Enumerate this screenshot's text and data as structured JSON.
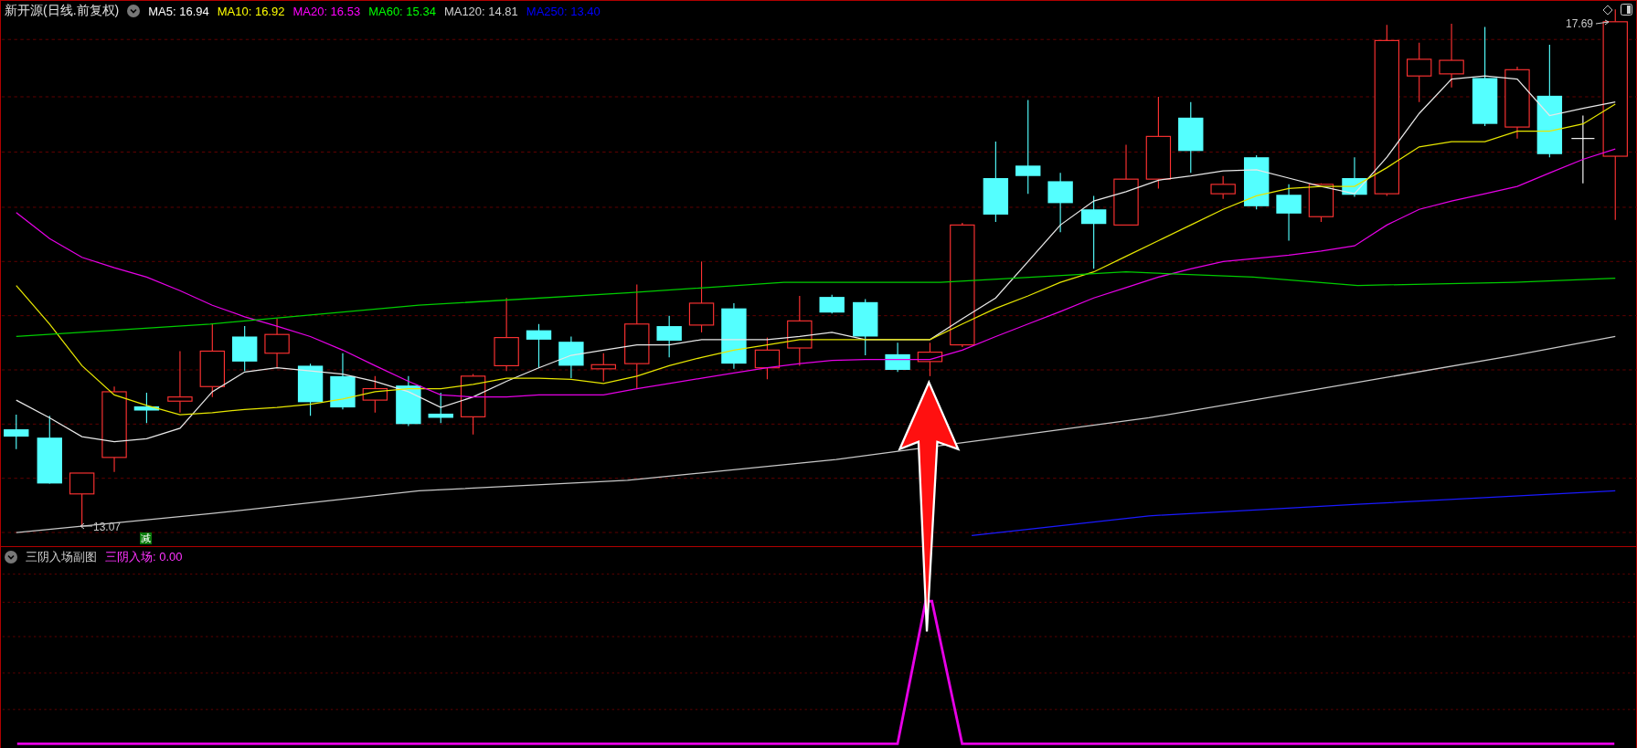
{
  "main_chart": {
    "title": "新开源(日线.前复权)",
    "moving_averages": [
      {
        "label": "MA5: 16.94",
        "color": "#ffffff"
      },
      {
        "label": "MA10: 16.92",
        "color": "#ffff00"
      },
      {
        "label": "MA20: 16.53",
        "color": "#ff00ff"
      },
      {
        "label": "MA60: 15.34",
        "color": "#00ff00"
      },
      {
        "label": "MA120: 14.81",
        "color": "#d0d0d0"
      },
      {
        "label": "MA250: 13.40",
        "color": "#0000ff"
      }
    ],
    "high_marker": "17.69",
    "low_marker": "13.07",
    "signal_badge": "减"
  },
  "sub_chart": {
    "title": "三阴入场副图",
    "indicator": "三阴入场: 0.00"
  }
}
